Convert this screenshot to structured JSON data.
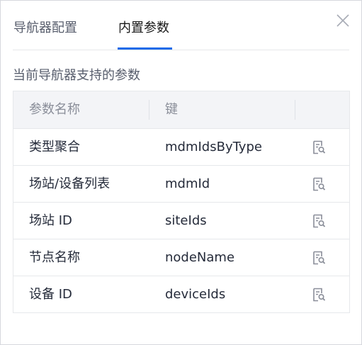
{
  "tabs": [
    {
      "label": "导航器配置",
      "active": false
    },
    {
      "label": "内置参数",
      "active": true
    }
  ],
  "section_title": "当前导航器支持的参数",
  "table": {
    "headers": [
      "参数名称",
      "键"
    ],
    "rows": [
      {
        "name": "类型聚合",
        "key": "mdmIdsByType"
      },
      {
        "name": "场站/设备列表",
        "key": "mdmId"
      },
      {
        "name": "场站 ID",
        "key": "siteIds"
      },
      {
        "name": "节点名称",
        "key": "nodeName"
      },
      {
        "name": "设备 ID",
        "key": "deviceIds"
      }
    ],
    "row_action_icon": "doc-search-icon"
  },
  "close_icon": "close-icon",
  "colors": {
    "accent": "#1a6ae8",
    "header_bg": "#f3f4f7",
    "border": "#e6e8eb",
    "text": "#252b3a",
    "muted": "#8a8e99"
  }
}
